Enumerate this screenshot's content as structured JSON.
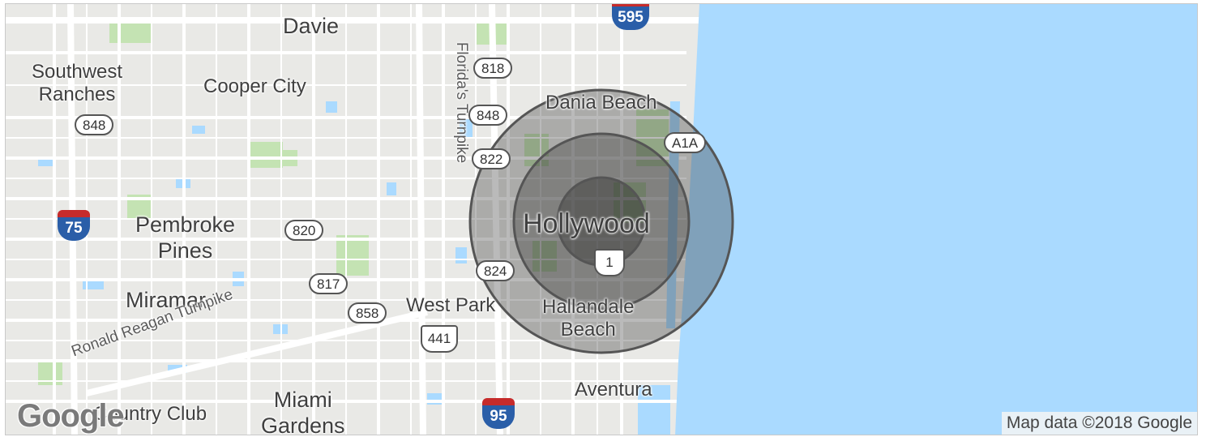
{
  "map": {
    "cities": [
      {
        "id": "davie",
        "label": "Davie"
      },
      {
        "id": "southwest-ranches",
        "label": "Southwest\nRanches"
      },
      {
        "id": "cooper-city",
        "label": "Cooper City"
      },
      {
        "id": "dania-beach",
        "label": "Dania Beach"
      },
      {
        "id": "hollywood",
        "label": "Hollywood"
      },
      {
        "id": "pembroke-pines",
        "label": "Pembroke\nPines"
      },
      {
        "id": "miramar",
        "label": "Miramar"
      },
      {
        "id": "west-park",
        "label": "West Park"
      },
      {
        "id": "hallandale-beach",
        "label": "Hallandale\nBeach"
      },
      {
        "id": "aventura",
        "label": "Aventura"
      },
      {
        "id": "miami-gardens",
        "label": "Miami\nGardens"
      },
      {
        "id": "country-club",
        "label": "Country Club"
      }
    ],
    "roads": [
      {
        "id": "floridas-turnpike",
        "label": "Florida's Turnpike"
      },
      {
        "id": "ronald-reagan-turnpike",
        "label": "Ronald Reagan Turnpike"
      }
    ],
    "shields": [
      {
        "id": "818",
        "label": "818"
      },
      {
        "id": "848a",
        "label": "848"
      },
      {
        "id": "848b",
        "label": "848"
      },
      {
        "id": "822",
        "label": "822"
      },
      {
        "id": "820",
        "label": "820"
      },
      {
        "id": "824",
        "label": "824"
      },
      {
        "id": "817",
        "label": "817"
      },
      {
        "id": "858",
        "label": "858"
      },
      {
        "id": "a1a",
        "label": "A1A"
      }
    ],
    "us_routes": [
      {
        "id": "us-1",
        "label": "1"
      },
      {
        "id": "us-441",
        "label": "441"
      }
    ],
    "interstates": [
      {
        "id": "i-595",
        "label": "595"
      },
      {
        "id": "i-75",
        "label": "75"
      },
      {
        "id": "i-95",
        "label": "95"
      }
    ],
    "radius_rings": 3,
    "attribution": "Map data ©2018 Google",
    "logo": "Google",
    "colors": {
      "water": "#aadaff",
      "land": "#e9e9e6",
      "park": "#c4e3b3",
      "road": "#ffffff",
      "ring": "#555555"
    }
  }
}
